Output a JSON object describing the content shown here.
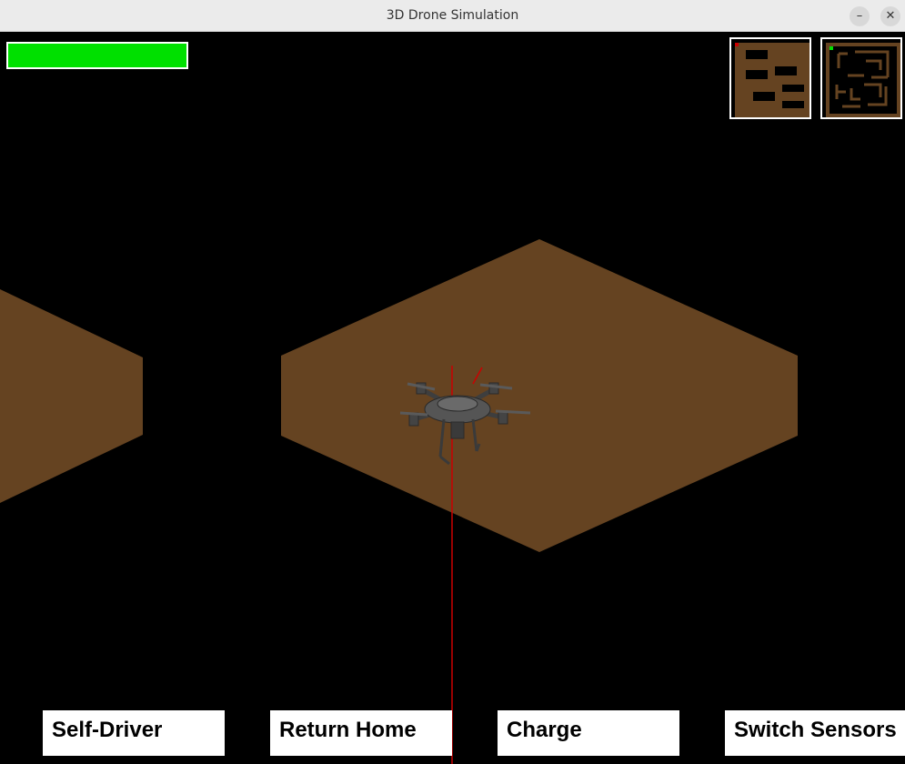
{
  "window": {
    "title": "3D Drone Simulation",
    "minimize_glyph": "–",
    "close_glyph": "✕"
  },
  "hud": {
    "battery_level": 1.0,
    "battery_color": "#00e000"
  },
  "scene": {
    "floor_color": "#654321",
    "drone_color": "#4a4a4a",
    "laser_color": "#cc0000"
  },
  "controls": {
    "self_driver": "Self-Driver",
    "return_home": "Return Home",
    "charge": "Charge",
    "switch_sensors": "Switch Sensors"
  }
}
